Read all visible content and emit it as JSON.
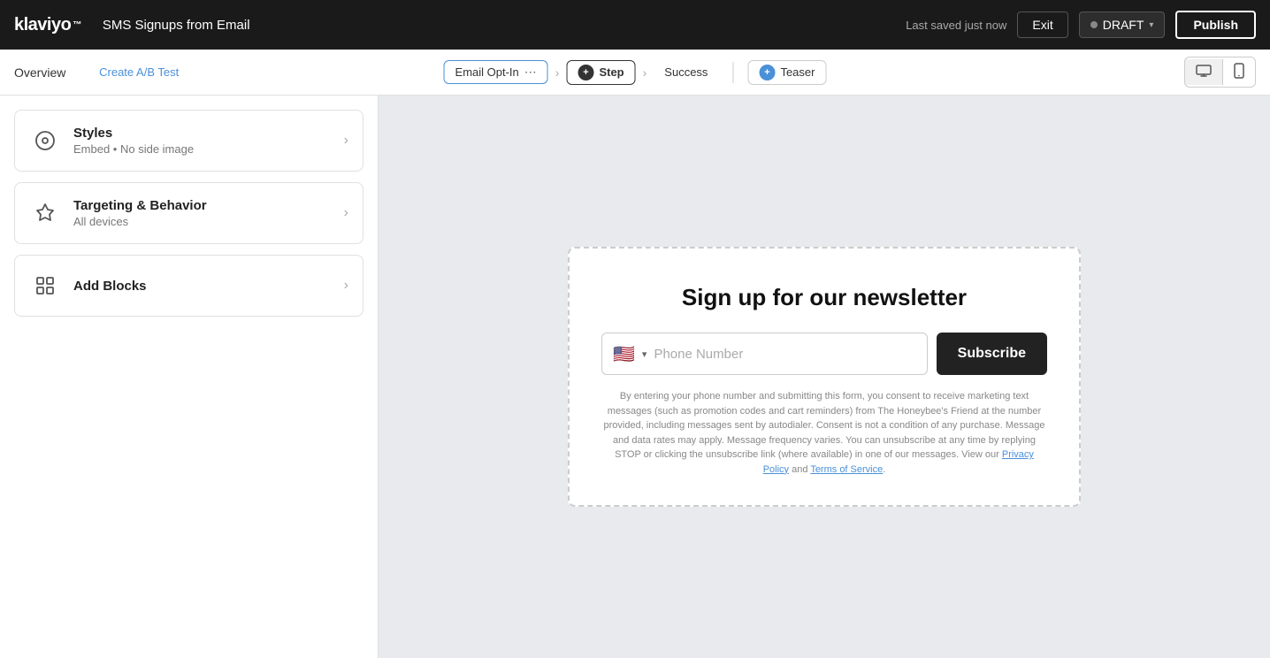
{
  "app": {
    "logo": "klaviyo",
    "page_title": "SMS Signups from Email"
  },
  "top_nav": {
    "last_saved": "Last saved just now",
    "exit_label": "Exit",
    "draft_label": "DRAFT",
    "publish_label": "Publish"
  },
  "sub_nav": {
    "overview_label": "Overview",
    "create_ab_label": "Create A/B Test",
    "email_opt_in_label": "Email Opt-In",
    "step_label": "Step",
    "success_label": "Success",
    "teaser_label": "Teaser"
  },
  "sidebar": {
    "styles": {
      "title": "Styles",
      "subtitle": "Embed • No side image"
    },
    "targeting": {
      "title": "Targeting & Behavior",
      "subtitle": "All devices"
    },
    "add_blocks": {
      "title": "Add Blocks"
    }
  },
  "form": {
    "title": "Sign up for our newsletter",
    "phone_placeholder": "Phone Number",
    "subscribe_label": "Subscribe",
    "disclaimer": "By entering your phone number and submitting this form, you consent to receive marketing text messages (such as promotion codes and cart reminders) from The Honeybee's Friend at the number provided, including messages sent by autodialer. Consent is not a condition of any purchase. Message and data rates may apply. Message frequency varies. You can unsubscribe at any time by replying STOP or clicking the unsubscribe link (where available) in one of our messages. View our",
    "privacy_label": "Privacy Policy",
    "and_text": "and",
    "tos_label": "Terms of Service",
    "period": "."
  }
}
